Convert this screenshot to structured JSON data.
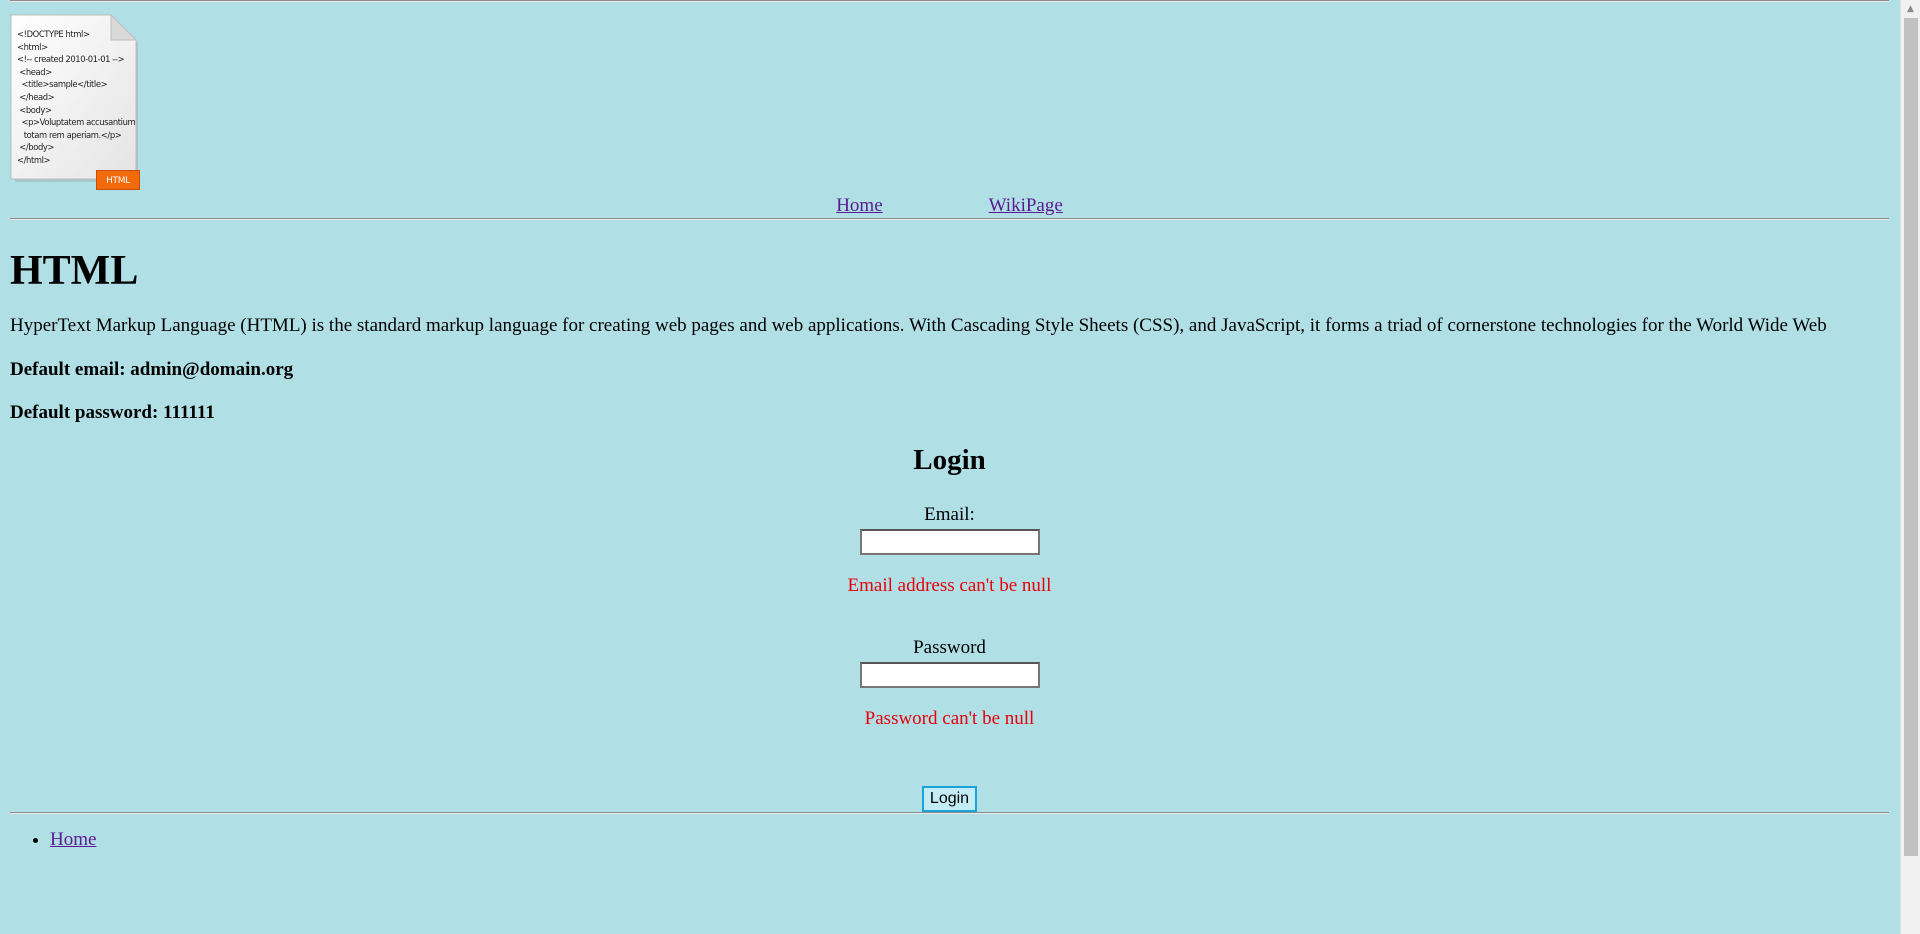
{
  "header": {
    "logo": {
      "icon": "html-document-icon",
      "code_lines": [
        "<!DOCTYPE html>",
        "<html>",
        "<!-- created 2010-01-01 -->",
        " <head>",
        "  <title>sample</title>",
        " </head>",
        " <body>",
        "  <p>Voluptatem accusantium",
        "   totam rem aperiam.</p>",
        " </body>",
        "</html>"
      ],
      "badge": "HTML"
    },
    "nav": {
      "home": "Home",
      "wiki": "WikiPage"
    }
  },
  "main": {
    "title": "HTML",
    "description": "HyperText Markup Language (HTML) is the standard markup language for creating web pages and web applications. With Cascading Style Sheets (CSS), and JavaScript, it forms a triad of cornerstone technologies for the World Wide Web",
    "default_email": "Default email: admin@domain.org",
    "default_password": "Default password: 111111"
  },
  "login": {
    "heading": "Login",
    "email_label": "Email:",
    "email_value": "",
    "email_error": "Email address can't be null",
    "password_label": "Password",
    "password_value": "",
    "password_error": "Password can't be null",
    "submit_label": "Login"
  },
  "footer": {
    "links": [
      "Home"
    ]
  },
  "colors": {
    "background": "#b0dfe5",
    "link": "#5b1a91",
    "error": "#e8000a",
    "button_border": "#1aa3d9"
  }
}
